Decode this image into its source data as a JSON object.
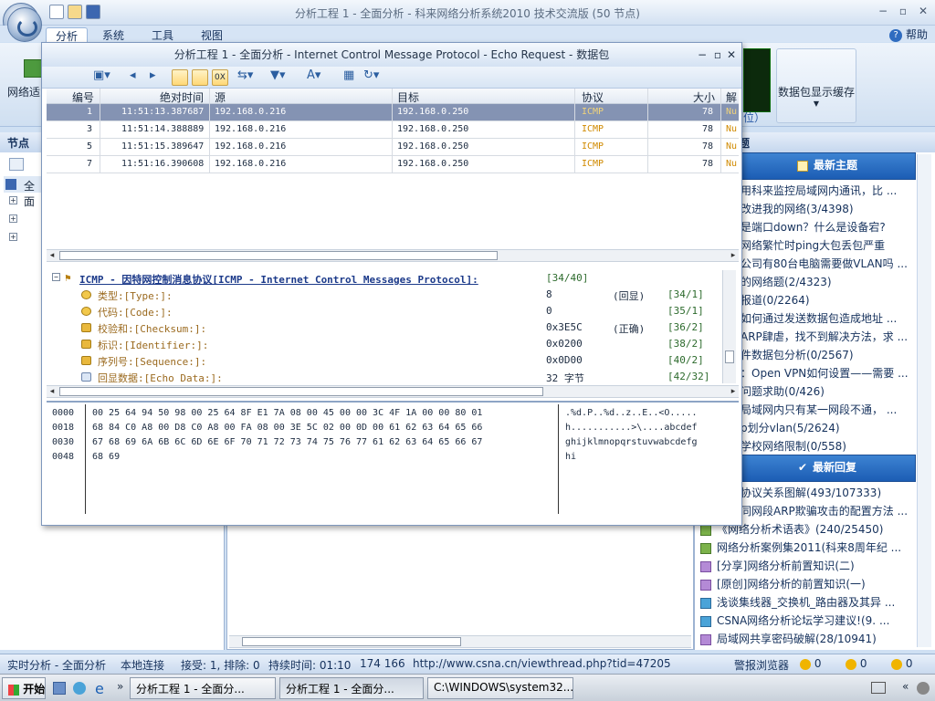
{
  "app": {
    "title": "分析工程 1 - 全面分析 - 科来网络分析系统2010 技术交流版 (50 节点)",
    "help": "帮助",
    "tabs": [
      "分析",
      "系统",
      "工具",
      "视图"
    ],
    "ribbon_left_label": "网络适",
    "ribbon_right_label": "数据包显示缓存",
    "ribbon_right_partial": "位）"
  },
  "left_panel": {
    "header": "节点浏",
    "tree_root": "全面"
  },
  "packet_window": {
    "title": "分析工程 1 - 全面分析 - Internet Control Message Protocol - Echo Request - 数据包",
    "columns": [
      "编号",
      "绝对时间",
      "源",
      "目标",
      "协议",
      "大小",
      "解"
    ],
    "rows": [
      {
        "no": "1",
        "time": "11:51:13.387687",
        "src": "192.168.0.216",
        "dst": "192.168.0.250",
        "proto": "ICMP",
        "size": "78",
        "decode": "Nu",
        "selected": true
      },
      {
        "no": "3",
        "time": "11:51:14.388889",
        "src": "192.168.0.216",
        "dst": "192.168.0.250",
        "proto": "ICMP",
        "size": "78",
        "decode": "Nu",
        "selected": false
      },
      {
        "no": "5",
        "time": "11:51:15.389647",
        "src": "192.168.0.216",
        "dst": "192.168.0.250",
        "proto": "ICMP",
        "size": "78",
        "decode": "Nu",
        "selected": false
      },
      {
        "no": "7",
        "time": "11:51:16.390608",
        "src": "192.168.0.216",
        "dst": "192.168.0.250",
        "proto": "ICMP",
        "size": "78",
        "decode": "Nu",
        "selected": false
      }
    ],
    "decode": {
      "root": "ICMP - 因特网控制消息协议[ICMP - Internet Control Messages Protocol]:",
      "root_pos": "[34/40]",
      "fields": [
        {
          "name": "类型:[Type:]:",
          "value": "8",
          "note": "(回显)",
          "pos": "[34/1]"
        },
        {
          "name": "代码:[Code:]:",
          "value": "0",
          "note": "",
          "pos": "[35/1]"
        },
        {
          "name": "校验和:[Checksum:]:",
          "value": "0x3E5C",
          "note": "(正确)",
          "pos": "[36/2]"
        },
        {
          "name": "标识:[Identifier:]:",
          "value": "0x0200",
          "note": "",
          "pos": "[38/2]"
        },
        {
          "name": "序列号:[Sequence:]:",
          "value": "0x0D00",
          "note": "",
          "pos": "[40/2]"
        },
        {
          "name": "回显数据:[Echo Data:]:",
          "value": "32 字节",
          "note": "",
          "pos": "[42/32]"
        }
      ]
    },
    "hex": [
      {
        "offset": "0000",
        "bytes": "00 25 64 94 50 98 00 25 64 8F E1 7A 08 00 45 00 00 3C 4F 1A 00 00 80 01",
        "ascii": ".%d.P..%d..z..E..<O....."
      },
      {
        "offset": "0018",
        "bytes": "68 84 C0 A8 00 D8 C0 A8 00 FA 08 00 3E 5C 02 00 0D 00 61 62 63 64 65 66",
        "ascii": "h...........>\\....abcdef"
      },
      {
        "offset": "0030",
        "bytes": "67 68 69 6A 6B 6C 6D 6E 6F 70 71 72 73 74 75 76 77 61 62 63 64 65 66 67",
        "ascii": "ghijklmnopqrstuvwabcdefg"
      },
      {
        "offset": "0048",
        "bytes": "68 69",
        "ascii": "hi"
      }
    ]
  },
  "right_panel": {
    "header": "题",
    "latest_topics_title": "最新主题",
    "latest_topics": [
      "用科来监控局域网内通讯，比 ...",
      "改进我的网络(3/4398)",
      "是端口down？什么是设备宕?",
      "网络繁忙时ping大包丢包严重",
      "公司有80台电脑需要做VLAN吗 ...",
      "的网络题(2/4323)",
      "报道(0/2264)",
      "如何通过发送数据包造成地址 ...",
      "ARP肆虐，找不到解决方法，求 ...",
      "件数据包分析(0/2567)",
      "：Open VPN如何设置——需要 ...",
      "问题求助(0/426)",
      "局域网内只有某一网段不通， ...",
      "p划分vlan(5/2624)",
      "学校网络限制(0/558)"
    ],
    "latest_replies_title": "最新回复",
    "latest_replies": [
      "协议关系图解(493/107333)",
      "同网段ARP欺骗攻击的配置方法 ...",
      "《网络分析术语表》(240/25450)",
      "网络分析案例集2011(科来8周年纪 ...",
      "[分享]网络分析前置知识(二)",
      "[原创]网络分析的前置知识(一)",
      "浅谈集线器_交换机_路由器及其异 ...",
      "CSNA网络分析论坛学习建议!(9. ...",
      "局域网共享密码破解(28/10941)"
    ]
  },
  "status_bar": {
    "mode": "实时分析 - 全面分析",
    "connection": "本地连接",
    "counts": "接受: 1, 排除: 0",
    "duration": "持续时间: 01:10",
    "coords": "174  166",
    "url": "http://www.csna.cn/viewthread.php?tid=47205",
    "alarm": "警报浏览器",
    "alarm_counts": [
      "0",
      "0",
      "0"
    ]
  },
  "taskbar": {
    "start": "开始",
    "buttons": [
      "分析工程 1 - 全面分...",
      "分析工程 1 - 全面分...",
      "C:\\WINDOWS\\system32..."
    ]
  }
}
